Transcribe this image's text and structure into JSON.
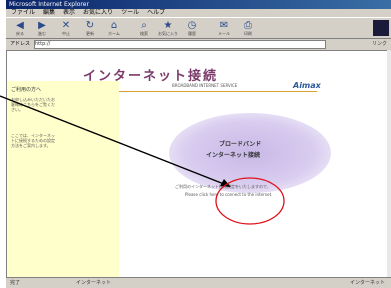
{
  "window": {
    "title": "Microsoft Internet Explorer",
    "menus": [
      "ファイル",
      "編集",
      "表示",
      "お気に入り",
      "ツール",
      "ヘルプ"
    ],
    "toolbar": [
      "戻る",
      "進む",
      "中止",
      "更新",
      "ホーム",
      "検索",
      "お気に入り",
      "履歴",
      "メール",
      "印刷"
    ],
    "address_label": "アドレス",
    "address_value": "http://",
    "go_label": "リンク"
  },
  "page": {
    "title": "インターネット接続",
    "subtitle": "BROADBAND INTERNET SERVICE",
    "brand": "Aimax",
    "sidebar_heading": "ご利用の方へ",
    "sidebar_text_1": "お申し込みいただいたお客様はこちらをご覧ください。",
    "sidebar_text_2": "ここでは、インターネットに接続するための設定方法をご案内します。",
    "cloud_line1": "ブロードバンド",
    "cloud_line2": "インターネット接続",
    "desc_line1": "ご利用のインターネット接続設定をいたしますので、",
    "desc_line2": "Please click here to connect to the internet."
  },
  "status": {
    "left": "完了",
    "mid": "インターネット",
    "right": "インターネット"
  },
  "annotation": {
    "arrow_color": "#000000",
    "circle_color": "#e0101a"
  }
}
